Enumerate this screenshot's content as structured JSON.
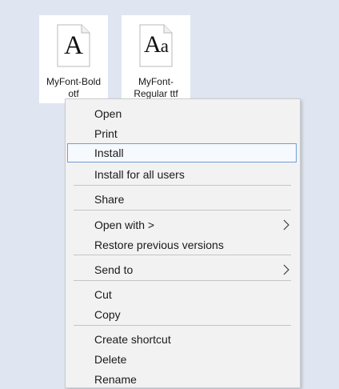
{
  "files": [
    {
      "name_line1": "MyFont-Bold",
      "name_line2": "otf",
      "glyph": "A"
    },
    {
      "name_line1": "MyFont-",
      "name_line2": "Regular ttf",
      "glyph_big": "A",
      "glyph_small": "a"
    }
  ],
  "menu": {
    "open": "Open",
    "print": "Print",
    "install": "Install",
    "install_all": "Install for all users",
    "share": "Share",
    "open_with": "Open with >",
    "restore": "Restore previous versions",
    "send_to": "Send to",
    "cut": "Cut",
    "copy": "Copy",
    "create_shortcut": "Create shortcut",
    "delete": "Delete",
    "rename": "Rename"
  },
  "colors": {
    "desktop": "#dfe6f1",
    "menu_bg": "#f2f2f2",
    "highlight_border": "#6f9fd8"
  }
}
